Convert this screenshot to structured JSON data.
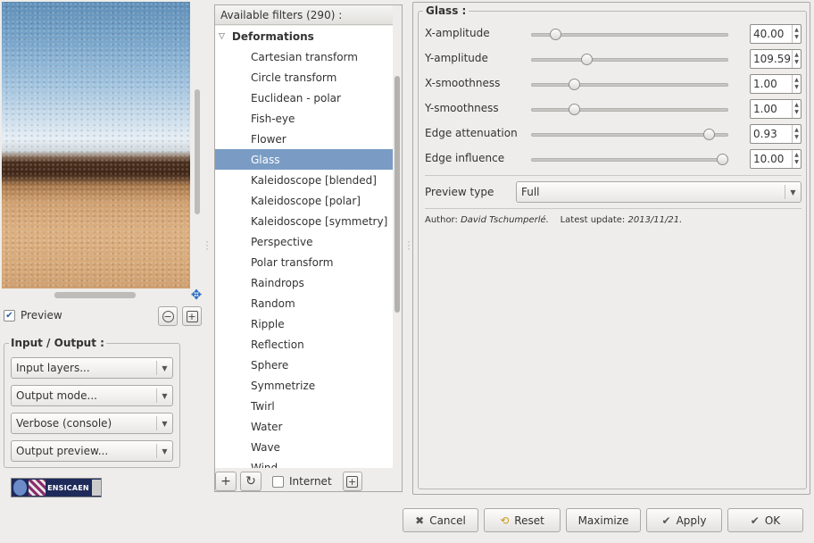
{
  "preview": {
    "checkbox_label": "Preview",
    "checked": true,
    "zoom_out_icon": "minus-circle-icon",
    "zoom_in_icon": "plus-box-icon"
  },
  "io": {
    "title": "Input / Output :",
    "input_layers": "Input layers...",
    "output_mode": "Output mode...",
    "verbose": "Verbose (console)",
    "output_preview": "Output preview..."
  },
  "logo": {
    "text": "ENSICAEN"
  },
  "filters": {
    "header": "Available filters (290) :",
    "category": "Deformations",
    "items": [
      "Cartesian transform",
      "Circle transform",
      "Euclidean - polar",
      "Fish-eye",
      "Flower",
      "Glass",
      "Kaleidoscope [blended]",
      "Kaleidoscope [polar]",
      "Kaleidoscope [symmetry]",
      "Perspective",
      "Polar transform",
      "Raindrops",
      "Random",
      "Ripple",
      "Reflection",
      "Sphere",
      "Symmetrize",
      "Twirl",
      "Water",
      "Wave",
      "Wind"
    ],
    "selected_index": 5,
    "internet_label": "Internet"
  },
  "params": {
    "title": "Glass :",
    "sliders": [
      {
        "label": "X-amplitude",
        "value": "40.00",
        "fraction": 0.1
      },
      {
        "label": "Y-amplitude",
        "value": "109.59",
        "fraction": 0.27
      },
      {
        "label": "X-smoothness",
        "value": "1.00",
        "fraction": 0.2
      },
      {
        "label": "Y-smoothness",
        "value": "1.00",
        "fraction": 0.2
      },
      {
        "label": "Edge attenuation",
        "value": "0.93",
        "fraction": 0.93
      },
      {
        "label": "Edge influence",
        "value": "10.00",
        "fraction": 1.0
      }
    ],
    "preview_type_label": "Preview type",
    "preview_type_value": "Full",
    "author_label": "Author:",
    "author_name": "David Tschumperlé.",
    "update_label": "Latest update:",
    "update_date": "2013/11/21."
  },
  "buttons": {
    "cancel": "Cancel",
    "reset": "Reset",
    "maximize": "Maximize",
    "apply": "Apply",
    "ok": "OK"
  }
}
